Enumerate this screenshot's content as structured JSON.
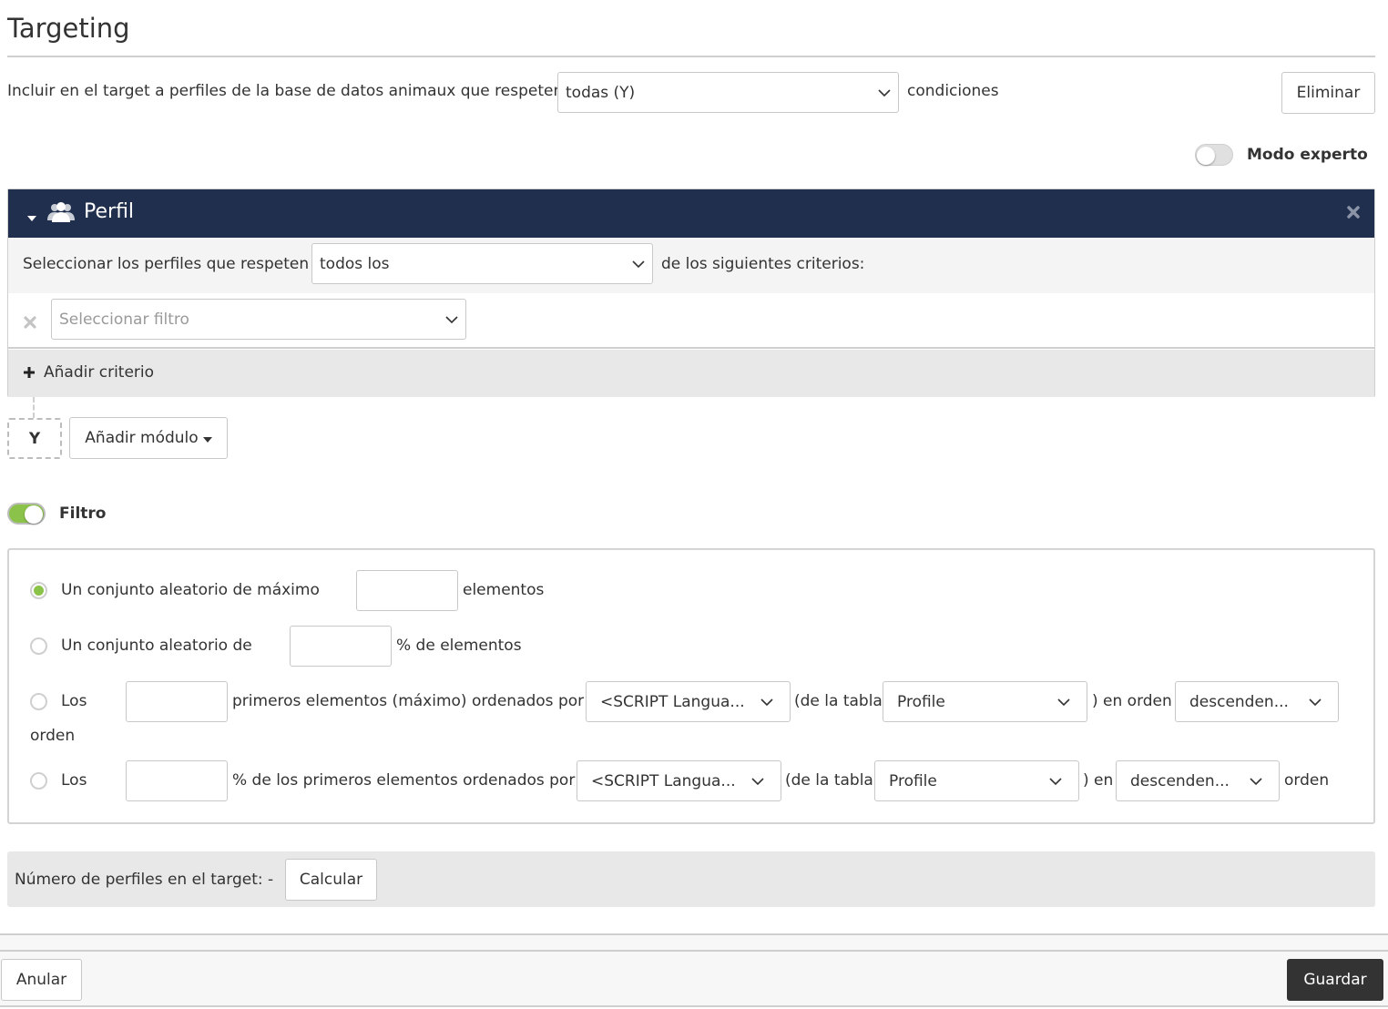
{
  "page": {
    "title": "Targeting"
  },
  "include_row": {
    "prefix": "Incluir en el target a perfiles de la base de datos animaux que respeten",
    "condition_select": "todas (Y)",
    "suffix": "condiciones",
    "delete_button": "Eliminar"
  },
  "expert_mode": {
    "label": "Modo experto",
    "enabled": false
  },
  "module": {
    "title": "Perfil",
    "icon": "users-icon",
    "select_prefix": "Seleccionar los perfiles que respeten",
    "criteria_select": "todos los",
    "select_suffix": "de los siguientes criterios:",
    "filter_placeholder": "Seleccionar filtro",
    "add_criterion": "Añadir criterio"
  },
  "operator": {
    "label": "Y"
  },
  "add_module": {
    "label": "Añadir módulo"
  },
  "filter": {
    "label": "Filtro",
    "enabled": true,
    "options": [
      {
        "prefix": "Un conjunto aleatorio de máximo",
        "value": "",
        "suffix": "elementos",
        "checked": true
      },
      {
        "prefix": "Un conjunto aleatorio de",
        "value": "",
        "suffix": "% de elementos",
        "checked": false
      },
      {
        "prefix": "Los",
        "value": "",
        "middle": "primeros elementos (máximo) ordenados por",
        "field_select": "<SCRIPT Langua...",
        "table_label": "(de la tabla",
        "table_select": "Profile",
        "order_label": ") en orden",
        "order_select": "descenden...",
        "trailing": "orden",
        "checked": false
      },
      {
        "prefix": "Los",
        "value": "",
        "middle": "% de los primeros elementos ordenados por",
        "field_select": "<SCRIPT Langua...",
        "table_label": "(de la tabla",
        "table_select": "Profile",
        "order_label": ") en",
        "order_select": "descenden...",
        "trailing": "orden",
        "checked": false
      }
    ]
  },
  "count": {
    "label": "Número de perfiles en el target: -",
    "button": "Calcular"
  },
  "footer": {
    "cancel": "Anular",
    "save": "Guardar"
  },
  "colors": {
    "module_header": "#1f2f4d",
    "accent_green": "#8bc34a",
    "save_button": "#333333"
  }
}
